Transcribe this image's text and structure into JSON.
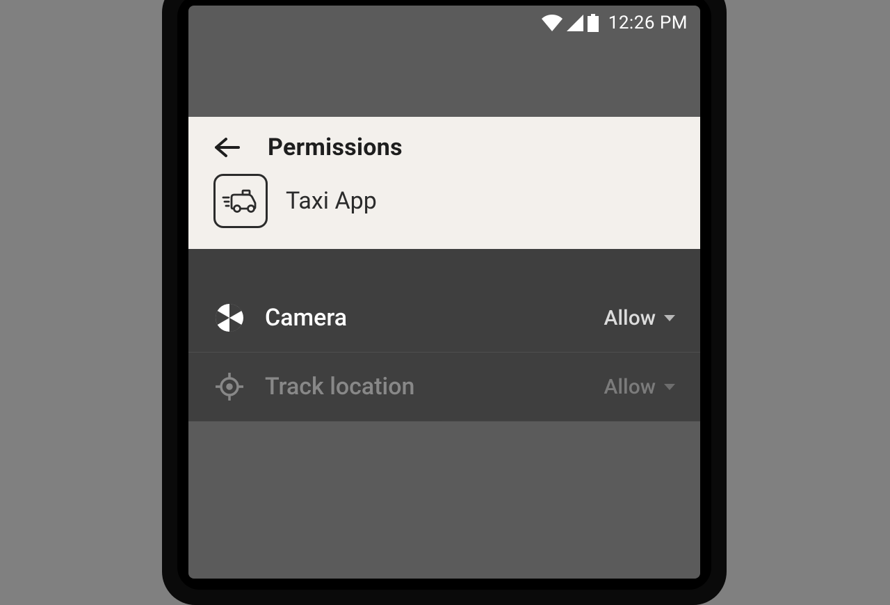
{
  "status": {
    "time": "12:26 PM"
  },
  "header": {
    "title": "Permissions",
    "app_name": "Taxi App"
  },
  "permissions": [
    {
      "icon": "camera-icon",
      "label": "Camera",
      "value": "Allow",
      "dimmed": false
    },
    {
      "icon": "location-icon",
      "label": "Track location",
      "value": "Allow",
      "dimmed": true
    }
  ]
}
